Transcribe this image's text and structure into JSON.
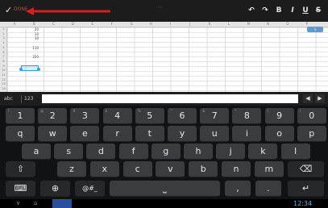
{
  "toolbar": {
    "done_label": "DONE",
    "center_text": "...",
    "undo_icon": "undo-icon",
    "redo_icon": "redo-icon",
    "bold_label": "B",
    "italic_label": "I",
    "underline_label": "U",
    "strike_label": "S"
  },
  "sheet": {
    "columns": [
      "A",
      "B",
      "C",
      "D",
      "E",
      "F",
      "G",
      "H",
      "I",
      "J",
      "K",
      "L",
      "M",
      "N",
      "O",
      "P"
    ],
    "rows": [
      "1",
      "2",
      "3",
      "4",
      "5",
      "6",
      "7",
      "8",
      "9",
      "10",
      "11",
      "12",
      "13",
      "14"
    ],
    "values": [
      "20",
      "30",
      "30",
      "",
      "110",
      "",
      "220"
    ],
    "badge_label": "1"
  },
  "formula_bar": {
    "mode_abc": "abc",
    "mode_123": "123",
    "left_btn": "◀",
    "right_btn": "▶"
  },
  "keyboard": {
    "row_numbers": [
      "1",
      "2",
      "3",
      "4",
      "5",
      "6",
      "7",
      "8",
      "9",
      "0"
    ],
    "row_numbers_hints": [
      "!",
      "@",
      "#",
      "$",
      "%",
      "^",
      "&",
      "*",
      "(",
      ")"
    ],
    "row1": [
      "q",
      "w",
      "e",
      "r",
      "t",
      "y",
      "u",
      "i",
      "o",
      "p"
    ],
    "row2": [
      "a",
      "s",
      "d",
      "f",
      "g",
      "h",
      "j",
      "k",
      "l"
    ],
    "row3": [
      "z",
      "x",
      "c",
      "v",
      "b",
      "n",
      "m"
    ],
    "shift_label": "⇧",
    "backspace_label": "⌫",
    "settings_label": "⌨",
    "globe_label": "⊕",
    "symbols_label": "@#_",
    "space_label": "⎵",
    "comma_label": ",",
    "period_label": ".",
    "enter_label": "↵"
  },
  "navbar": {
    "back_label": "∨",
    "home_label": "⌂",
    "time": "12:34"
  },
  "colors": {
    "accent": "#35a4e0",
    "toolbar_bg": "#1c1c1c",
    "keyboard_bg": "#101214",
    "key_bg": "#3a3c40",
    "annotation_red": "#d02020"
  }
}
